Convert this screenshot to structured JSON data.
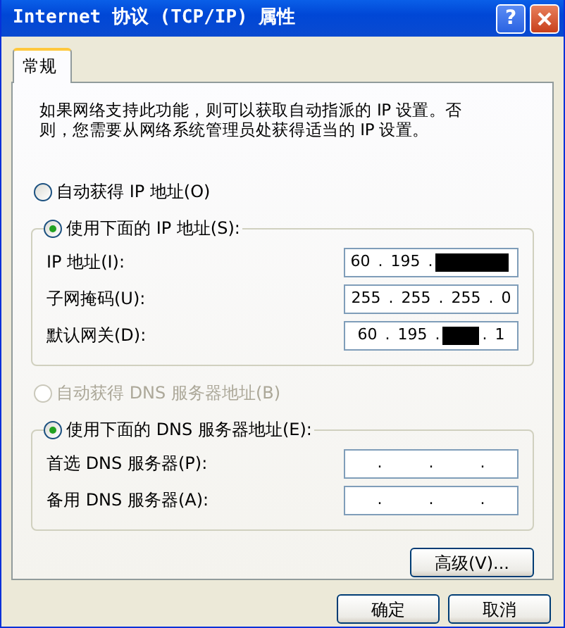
{
  "window": {
    "title": "Internet 协议 (TCP/IP) 属性",
    "help_button": "?"
  },
  "tabs": [
    {
      "label": "常规",
      "selected": true
    }
  ],
  "intro": "如果网络支持此功能，则可以获取自动指派的 IP 设置。否则，您需要从网络系统管理员处获得适当的 IP 设置。",
  "ip": {
    "auto_option": {
      "label": "自动获得 IP 地址(O)",
      "selected": false,
      "disabled": false
    },
    "manual_option": {
      "label": "使用下面的 IP 地址(S):",
      "selected": true,
      "disabled": false
    },
    "fields": [
      {
        "label": "IP 地址(I):",
        "parts": [
          {
            "kind": "text",
            "text": "60 . 195 ."
          },
          {
            "kind": "redacted-wide"
          }
        ]
      },
      {
        "label": "子网掩码(U):",
        "parts": [
          {
            "kind": "text",
            "text": "255 . 255 . 255 . 0"
          }
        ]
      },
      {
        "label": "默认网关(D):",
        "parts": [
          {
            "kind": "text",
            "text": "60 . 195 ."
          },
          {
            "kind": "redacted"
          },
          {
            "kind": "text",
            "text": ". 1"
          }
        ]
      }
    ]
  },
  "dns": {
    "auto_option": {
      "label": "自动获得 DNS 服务器地址(B)",
      "selected": false,
      "disabled": true
    },
    "manual_option": {
      "label": "使用下面的 DNS 服务器地址(E):",
      "selected": true,
      "disabled": false
    },
    "fields": [
      {
        "label": "首选 DNS 服务器(P):",
        "parts": [
          {
            "kind": "text",
            "text": ".      .      ."
          }
        ]
      },
      {
        "label": "备用 DNS 服务器(A):",
        "parts": [
          {
            "kind": "text",
            "text": ".      .      ."
          }
        ]
      }
    ]
  },
  "advanced_button": "高级(V)...",
  "buttons": [
    "确定",
    "取消"
  ]
}
